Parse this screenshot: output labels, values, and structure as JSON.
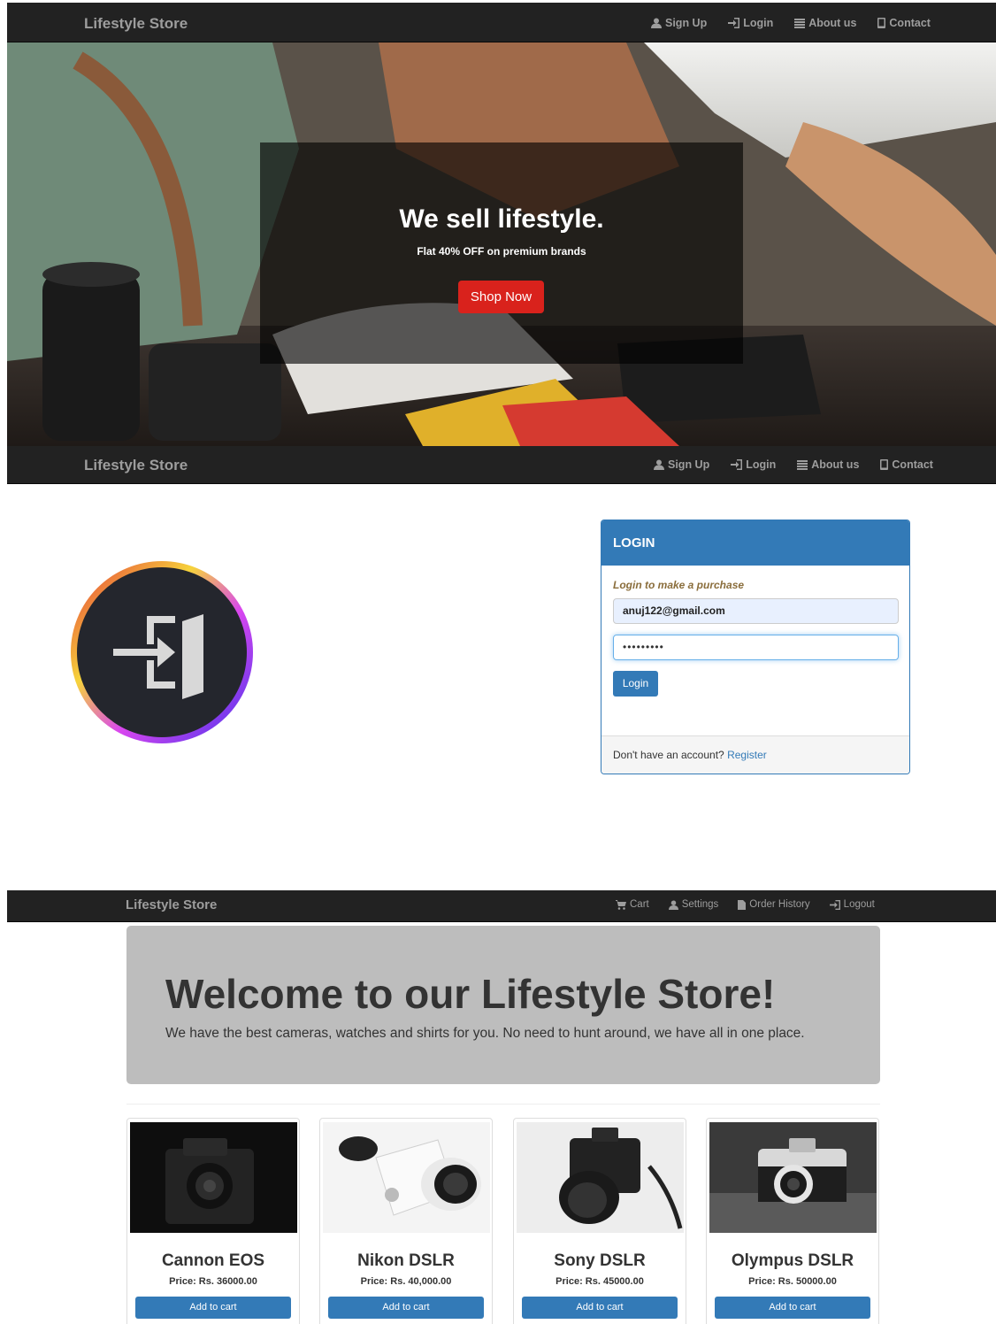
{
  "nav_top": {
    "brand": "Lifestyle Store",
    "links": [
      {
        "label": "Sign Up",
        "icon": "user-icon"
      },
      {
        "label": "Login",
        "icon": "login-icon"
      },
      {
        "label": "About us",
        "icon": "list-icon"
      },
      {
        "label": "Contact",
        "icon": "phone-icon"
      }
    ]
  },
  "hero": {
    "title": "We sell lifestyle.",
    "subtitle": "Flat 40% OFF on premium brands",
    "button": "Shop Now"
  },
  "nav_second": {
    "brand": "Lifestyle Store",
    "links": [
      {
        "label": "Sign Up",
        "icon": "user-icon"
      },
      {
        "label": "Login",
        "icon": "login-icon"
      },
      {
        "label": "About us",
        "icon": "list-icon"
      },
      {
        "label": "Contact",
        "icon": "phone-icon"
      }
    ]
  },
  "login_panel": {
    "heading": "LOGIN",
    "note": "Login to make a purchase",
    "email_value": "anuj122@gmail.com",
    "password_value": "•••••••••",
    "button": "Login",
    "footer_text": "Don't have an account?",
    "footer_link": "Register"
  },
  "nav_third": {
    "brand": "Lifestyle Store",
    "links": [
      {
        "label": "Cart",
        "icon": "cart-icon"
      },
      {
        "label": "Settings",
        "icon": "user-icon"
      },
      {
        "label": "Order History",
        "icon": "file-icon"
      },
      {
        "label": "Logout",
        "icon": "logout-icon"
      }
    ]
  },
  "jumbotron": {
    "title": "Welcome to our Lifestyle Store!",
    "text": "We have the best cameras, watches and shirts for you. No need to hunt around, we have all in one place."
  },
  "products": [
    {
      "name": "Cannon EOS",
      "price": "Price: Rs. 36000.00",
      "button": "Add to cart"
    },
    {
      "name": "Nikon DSLR",
      "price": "Price: Rs. 40,000.00",
      "button": "Add to cart"
    },
    {
      "name": "Sony DSLR",
      "price": "Price: Rs. 45000.00",
      "button": "Add to cart"
    },
    {
      "name": "Olympus DSLR",
      "price": "Price: Rs. 50000.00",
      "button": "Add to cart"
    }
  ],
  "colors": {
    "navbar": "#222222",
    "primary": "#337ab7",
    "shop_button": "#d9221c",
    "jumbotron": "#bdbdbd"
  }
}
